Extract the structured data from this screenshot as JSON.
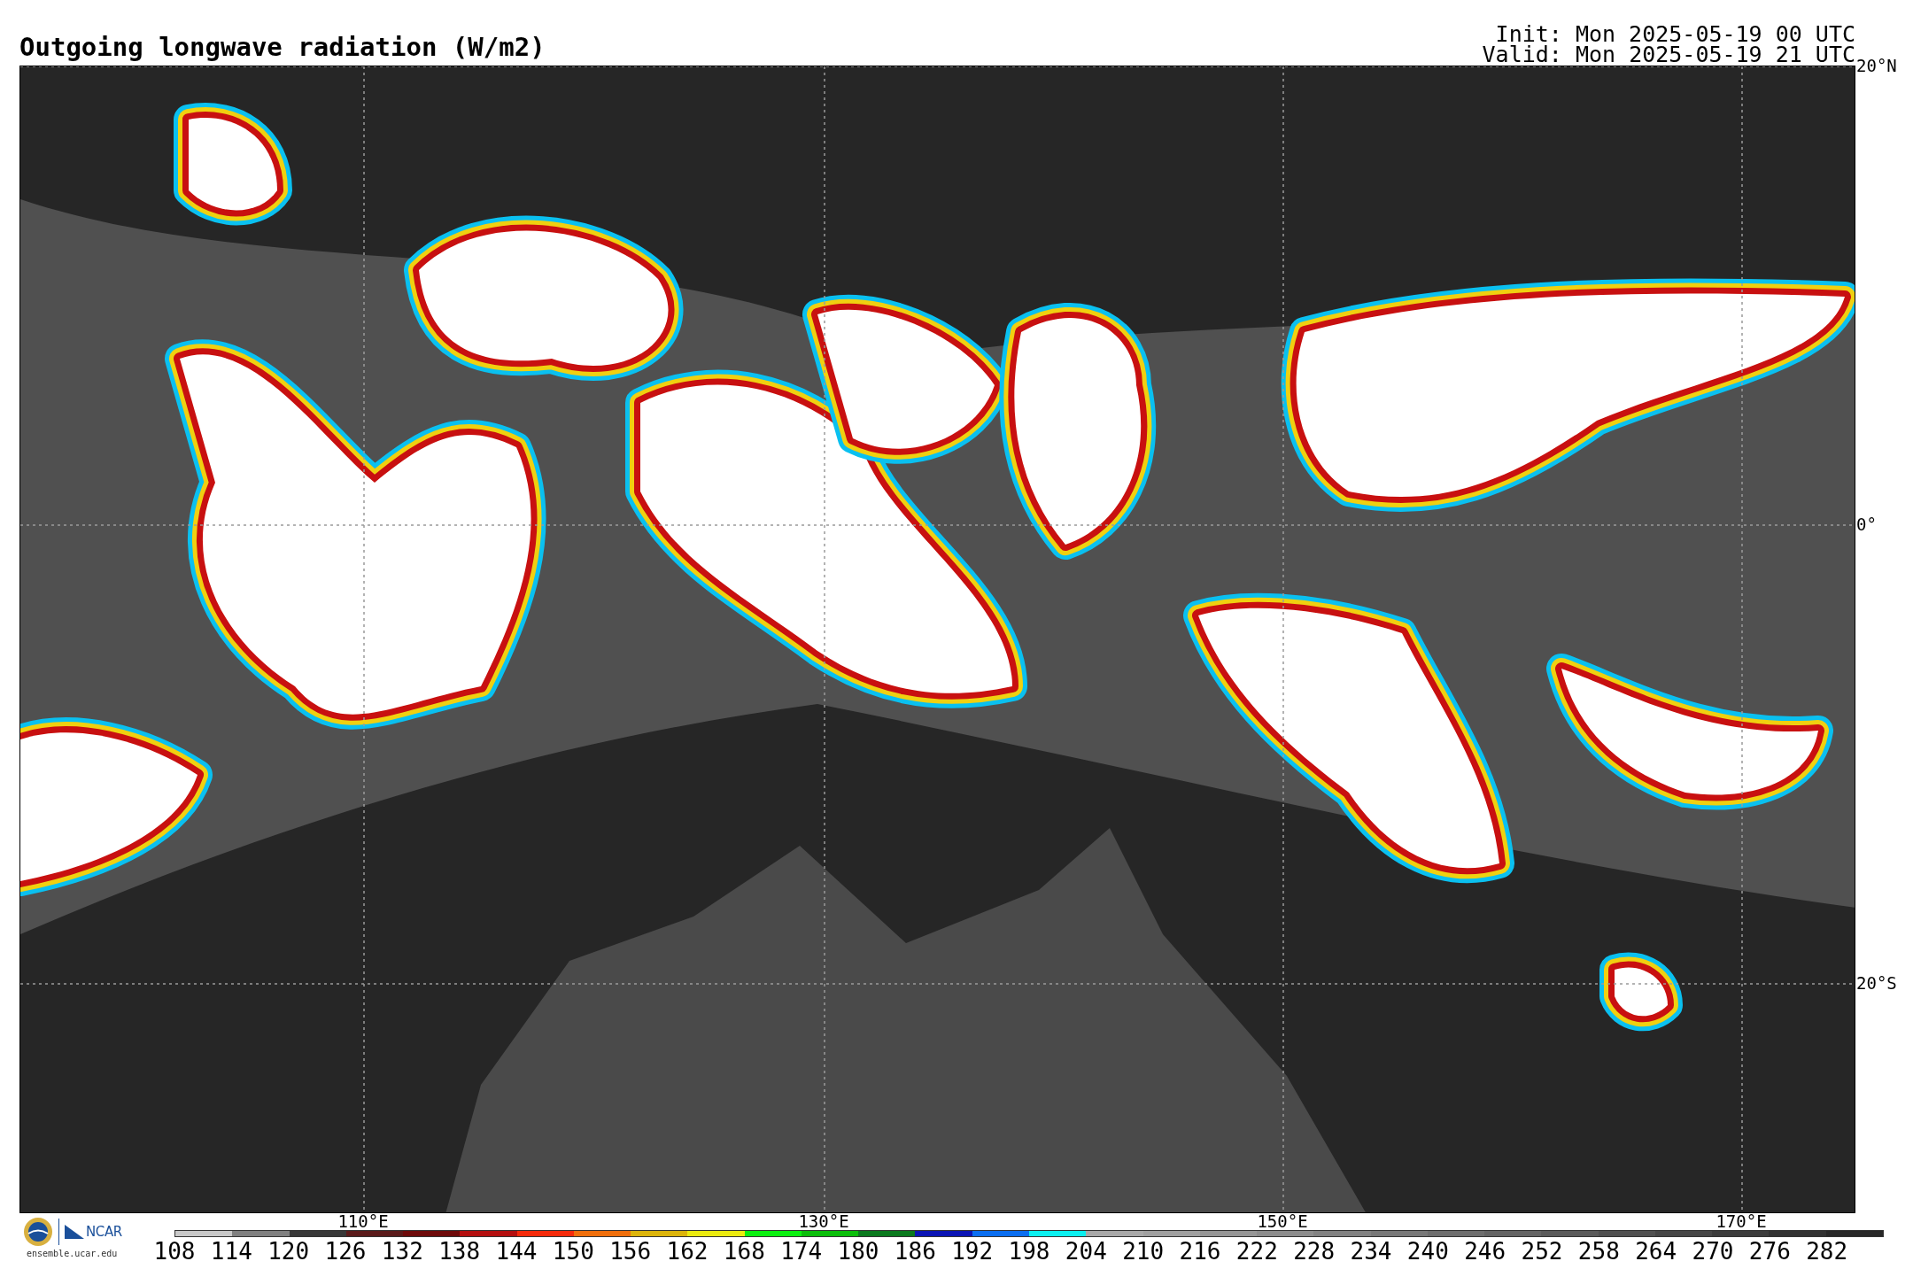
{
  "title": "Outgoing longwave radiation (W/m2)",
  "init": "Init: Mon 2025-05-19 00 UTC",
  "valid": "Valid: Mon 2025-05-19 21 UTC",
  "map": {
    "lat_labels": [
      "20°N",
      "0°",
      "20°S"
    ],
    "lon_labels": [
      "110°E",
      "130°E",
      "150°E",
      "170°E"
    ]
  },
  "logos": {
    "ncar": "NCAR",
    "site": "ensemble.ucar.edu"
  },
  "colorbar": [
    {
      "label": "108",
      "color": "#c8c8c8"
    },
    {
      "label": "114",
      "color": "#808080"
    },
    {
      "label": "120",
      "color": "#383838"
    },
    {
      "label": "126",
      "color": "#5a1a1a"
    },
    {
      "label": "132",
      "color": "#6e0a0a"
    },
    {
      "label": "138",
      "color": "#b40f0f"
    },
    {
      "label": "144",
      "color": "#f52a0a"
    },
    {
      "label": "150",
      "color": "#f06e0a"
    },
    {
      "label": "156",
      "color": "#dcb40a"
    },
    {
      "label": "162",
      "color": "#ebeb0f"
    },
    {
      "label": "168",
      "color": "#0af00f"
    },
    {
      "label": "174",
      "color": "#0abe0a"
    },
    {
      "label": "180",
      "color": "#0a7a1e"
    },
    {
      "label": "186",
      "color": "#0a14b4"
    },
    {
      "label": "192",
      "color": "#0a6ef0"
    },
    {
      "label": "198",
      "color": "#0af0f0"
    },
    {
      "label": "204",
      "color": "#a8a8a8"
    },
    {
      "label": "210",
      "color": "#a0a0a0"
    },
    {
      "label": "216",
      "color": "#969696"
    },
    {
      "label": "222",
      "color": "#8c8c8c"
    },
    {
      "label": "228",
      "color": "#828282"
    },
    {
      "label": "234",
      "color": "#787878"
    },
    {
      "label": "240",
      "color": "#6e6e6e"
    },
    {
      "label": "246",
      "color": "#646464"
    },
    {
      "label": "252",
      "color": "#5a5a5a"
    },
    {
      "label": "258",
      "color": "#505050"
    },
    {
      "label": "264",
      "color": "#464646"
    },
    {
      "label": "270",
      "color": "#3c3c3c"
    },
    {
      "label": "276",
      "color": "#323232"
    },
    {
      "label": "282",
      "color": "#282828"
    }
  ]
}
